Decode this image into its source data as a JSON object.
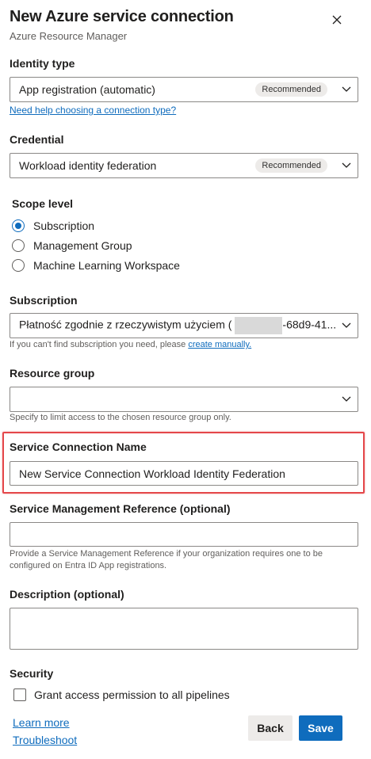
{
  "panel": {
    "title": "New Azure service connection",
    "subtitle": "Azure Resource Manager"
  },
  "identity_type": {
    "label": "Identity type",
    "value": "App registration (automatic)",
    "badge": "Recommended",
    "help_link": "Need help choosing a connection type?"
  },
  "credential": {
    "label": "Credential",
    "value": "Workload identity federation",
    "badge": "Recommended"
  },
  "scope_level": {
    "label": "Scope level",
    "options": [
      {
        "label": "Subscription",
        "checked": true
      },
      {
        "label": "Management Group",
        "checked": false
      },
      {
        "label": "Machine Learning Workspace",
        "checked": false
      }
    ]
  },
  "subscription": {
    "label": "Subscription",
    "value_prefix": "Płatność zgodnie z rzeczywistym użyciem (",
    "value_suffix": "-68d9-41...",
    "help_text": "If you can't find subscription you need, please",
    "help_link": "create manually."
  },
  "resource_group": {
    "label": "Resource group",
    "value": "",
    "help_text": "Specify to limit access to the chosen resource group only."
  },
  "service_connection_name": {
    "label": "Service Connection Name",
    "value": "New Service Connection Workload Identity Federation"
  },
  "service_management_reference": {
    "label": "Service Management Reference (optional)",
    "value": "",
    "help_text_line1": "Provide a Service Management Reference if your organization requires one to be",
    "help_text_line2": "configured on Entra ID App registrations."
  },
  "description": {
    "label": "Description (optional)",
    "value": ""
  },
  "security": {
    "label": "Security",
    "checkbox_label": "Grant access permission to all pipelines",
    "checked": false
  },
  "footer": {
    "learn_more": "Learn more",
    "troubleshoot": "Troubleshoot",
    "back_label": "Back",
    "save_label": "Save"
  },
  "colors": {
    "accent": "#0f6cbd",
    "highlight_border": "#e4474a",
    "badge_bg": "#edebe9"
  }
}
